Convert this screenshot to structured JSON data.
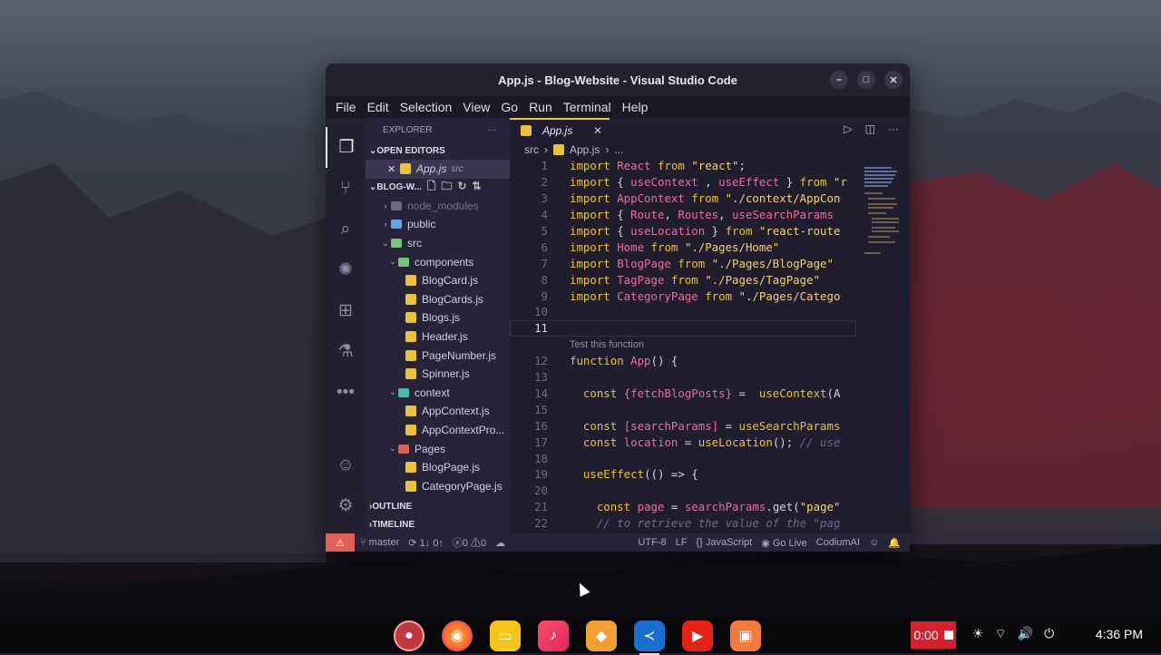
{
  "window": {
    "title": "App.js - Blog-Website - Visual Studio Code",
    "controls": [
      "–",
      "□",
      "✕"
    ]
  },
  "menu": [
    "File",
    "Edit",
    "Selection",
    "View",
    "Go",
    "Run",
    "Terminal",
    "Help"
  ],
  "sidebar": {
    "header": "EXPLORER",
    "more": "···",
    "open_editors_label": "OPEN EDITORS",
    "open_editor": {
      "name": "App.js",
      "hint": "src"
    },
    "project_label": "BLOG-W...",
    "tree": [
      {
        "name": "node_modules",
        "depth": 1,
        "kind": "folder-g",
        "state": "collapsed",
        "dim": true
      },
      {
        "name": "public",
        "depth": 1,
        "kind": "folder-b",
        "state": "collapsed"
      },
      {
        "name": "src",
        "depth": 1,
        "kind": "folder",
        "state": "expanded"
      },
      {
        "name": "components",
        "depth": 2,
        "kind": "folder",
        "state": "expanded"
      },
      {
        "name": "BlogCard.js",
        "depth": 3,
        "kind": "js"
      },
      {
        "name": "BlogCards.js",
        "depth": 3,
        "kind": "js"
      },
      {
        "name": "Blogs.js",
        "depth": 3,
        "kind": "js"
      },
      {
        "name": "Header.js",
        "depth": 3,
        "kind": "js"
      },
      {
        "name": "PageNumber.js",
        "depth": 3,
        "kind": "js"
      },
      {
        "name": "Spinner.js",
        "depth": 3,
        "kind": "js"
      },
      {
        "name": "context",
        "depth": 2,
        "kind": "folder-t",
        "state": "expanded"
      },
      {
        "name": "AppContext.js",
        "depth": 3,
        "kind": "js"
      },
      {
        "name": "AppContextPro...",
        "depth": 3,
        "kind": "js"
      },
      {
        "name": "Pages",
        "depth": 2,
        "kind": "folder-r",
        "state": "expanded"
      },
      {
        "name": "BlogPage.js",
        "depth": 3,
        "kind": "js"
      },
      {
        "name": "CategoryPage.js",
        "depth": 3,
        "kind": "js"
      }
    ],
    "outline_label": "OUTLINE",
    "timeline_label": "TIMELINE"
  },
  "editor": {
    "tab_name": "App.js",
    "breadcrumb": [
      "src",
      "App.js",
      "..."
    ],
    "codelens": "Test this function",
    "lines": [
      {
        "n": "1",
        "parts": [
          [
            "kw",
            "import "
          ],
          [
            "pink",
            "React"
          ],
          [
            "kw",
            " from "
          ],
          [
            "str",
            "\"react\""
          ],
          [
            "",
            "; "
          ]
        ]
      },
      {
        "n": "2",
        "parts": [
          [
            "kw",
            "import "
          ],
          [
            "",
            "{ "
          ],
          [
            "pink",
            "useContext"
          ],
          [
            "",
            " , "
          ],
          [
            "pink",
            "useEffect"
          ],
          [
            "",
            " } "
          ],
          [
            "kw",
            "from "
          ],
          [
            "str",
            "\"r"
          ]
        ]
      },
      {
        "n": "3",
        "parts": [
          [
            "kw",
            "import "
          ],
          [
            "pink",
            "AppContext"
          ],
          [
            "kw",
            " from "
          ],
          [
            "str",
            "\"./context/AppCon"
          ]
        ]
      },
      {
        "n": "4",
        "parts": [
          [
            "kw",
            "import "
          ],
          [
            "",
            "{ "
          ],
          [
            "pink",
            "Route"
          ],
          [
            "",
            ", "
          ],
          [
            "pink",
            "Routes"
          ],
          [
            "",
            ", "
          ],
          [
            "pink",
            "useSearchParams"
          ]
        ]
      },
      {
        "n": "5",
        "parts": [
          [
            "kw",
            "import "
          ],
          [
            "",
            "{ "
          ],
          [
            "pink",
            "useLocation"
          ],
          [
            "",
            " } "
          ],
          [
            "kw",
            "from "
          ],
          [
            "str",
            "\"react-route"
          ]
        ]
      },
      {
        "n": "6",
        "parts": [
          [
            "kw",
            "import "
          ],
          [
            "pink",
            "Home"
          ],
          [
            "kw",
            " from "
          ],
          [
            "str",
            "\"./Pages/Home\""
          ]
        ]
      },
      {
        "n": "7",
        "parts": [
          [
            "kw",
            "import "
          ],
          [
            "pink",
            "BlogPage"
          ],
          [
            "kw",
            " from "
          ],
          [
            "str",
            "\"./Pages/BlogPage\""
          ]
        ]
      },
      {
        "n": "8",
        "parts": [
          [
            "kw",
            "import "
          ],
          [
            "pink",
            "TagPage"
          ],
          [
            "kw",
            " from "
          ],
          [
            "str",
            "\"./Pages/TagPage\""
          ]
        ]
      },
      {
        "n": "9",
        "parts": [
          [
            "kw",
            "import "
          ],
          [
            "pink",
            "CategoryPage"
          ],
          [
            "kw",
            " from "
          ],
          [
            "str",
            "\"./Pages/Catego"
          ]
        ]
      },
      {
        "n": "10",
        "parts": []
      },
      {
        "n": "11",
        "parts": [],
        "current": true
      },
      {
        "lens": true
      },
      {
        "n": "12",
        "parts": [
          [
            "kw",
            "function "
          ],
          [
            "pink",
            "App"
          ],
          [
            "",
            "() {"
          ]
        ]
      },
      {
        "n": "13",
        "parts": []
      },
      {
        "n": "14",
        "parts": [
          [
            "",
            "  "
          ],
          [
            "kw",
            "const "
          ],
          [
            "pink",
            "{fetchBlogPosts}"
          ],
          [
            "",
            " =  "
          ],
          [
            "kw",
            "useContext"
          ],
          [
            "",
            "(A"
          ]
        ]
      },
      {
        "n": "15",
        "parts": []
      },
      {
        "n": "16",
        "parts": [
          [
            "",
            "  "
          ],
          [
            "kw",
            "const "
          ],
          [
            "pink",
            "[searchParams]"
          ],
          [
            "",
            " = "
          ],
          [
            "kw",
            "useSearchParams"
          ]
        ]
      },
      {
        "n": "17",
        "parts": [
          [
            "",
            "  "
          ],
          [
            "kw",
            "const "
          ],
          [
            "pink",
            "location"
          ],
          [
            "",
            " = "
          ],
          [
            "kw",
            "useLocation"
          ],
          [
            "",
            "(); "
          ],
          [
            "cm",
            "// use"
          ]
        ]
      },
      {
        "n": "18",
        "parts": []
      },
      {
        "n": "19",
        "parts": [
          [
            "",
            "  "
          ],
          [
            "kw",
            "useEffect"
          ],
          [
            "",
            "(() => {"
          ]
        ]
      },
      {
        "n": "20",
        "parts": []
      },
      {
        "n": "21",
        "parts": [
          [
            "",
            "    "
          ],
          [
            "kw",
            "const "
          ],
          [
            "pink",
            "page"
          ],
          [
            "",
            " = "
          ],
          [
            "pink",
            "searchParams"
          ],
          [
            "",
            ".get("
          ],
          [
            "str",
            "\"page\""
          ]
        ]
      },
      {
        "n": "22",
        "parts": [
          [
            "",
            "    "
          ],
          [
            "cm",
            "// to retrieve the value of the \"pag"
          ]
        ]
      }
    ]
  },
  "statusbar": {
    "branch": "master",
    "sync": "1↓ 0↑",
    "errors": "0",
    "warnings": "0",
    "encoding": "UTF-8",
    "eol": "LF",
    "language": "JavaScript",
    "live": "Go Live",
    "ext": "CodiumAI"
  },
  "taskbar": {
    "record_time": "0:00",
    "clock": "4:36 PM"
  }
}
